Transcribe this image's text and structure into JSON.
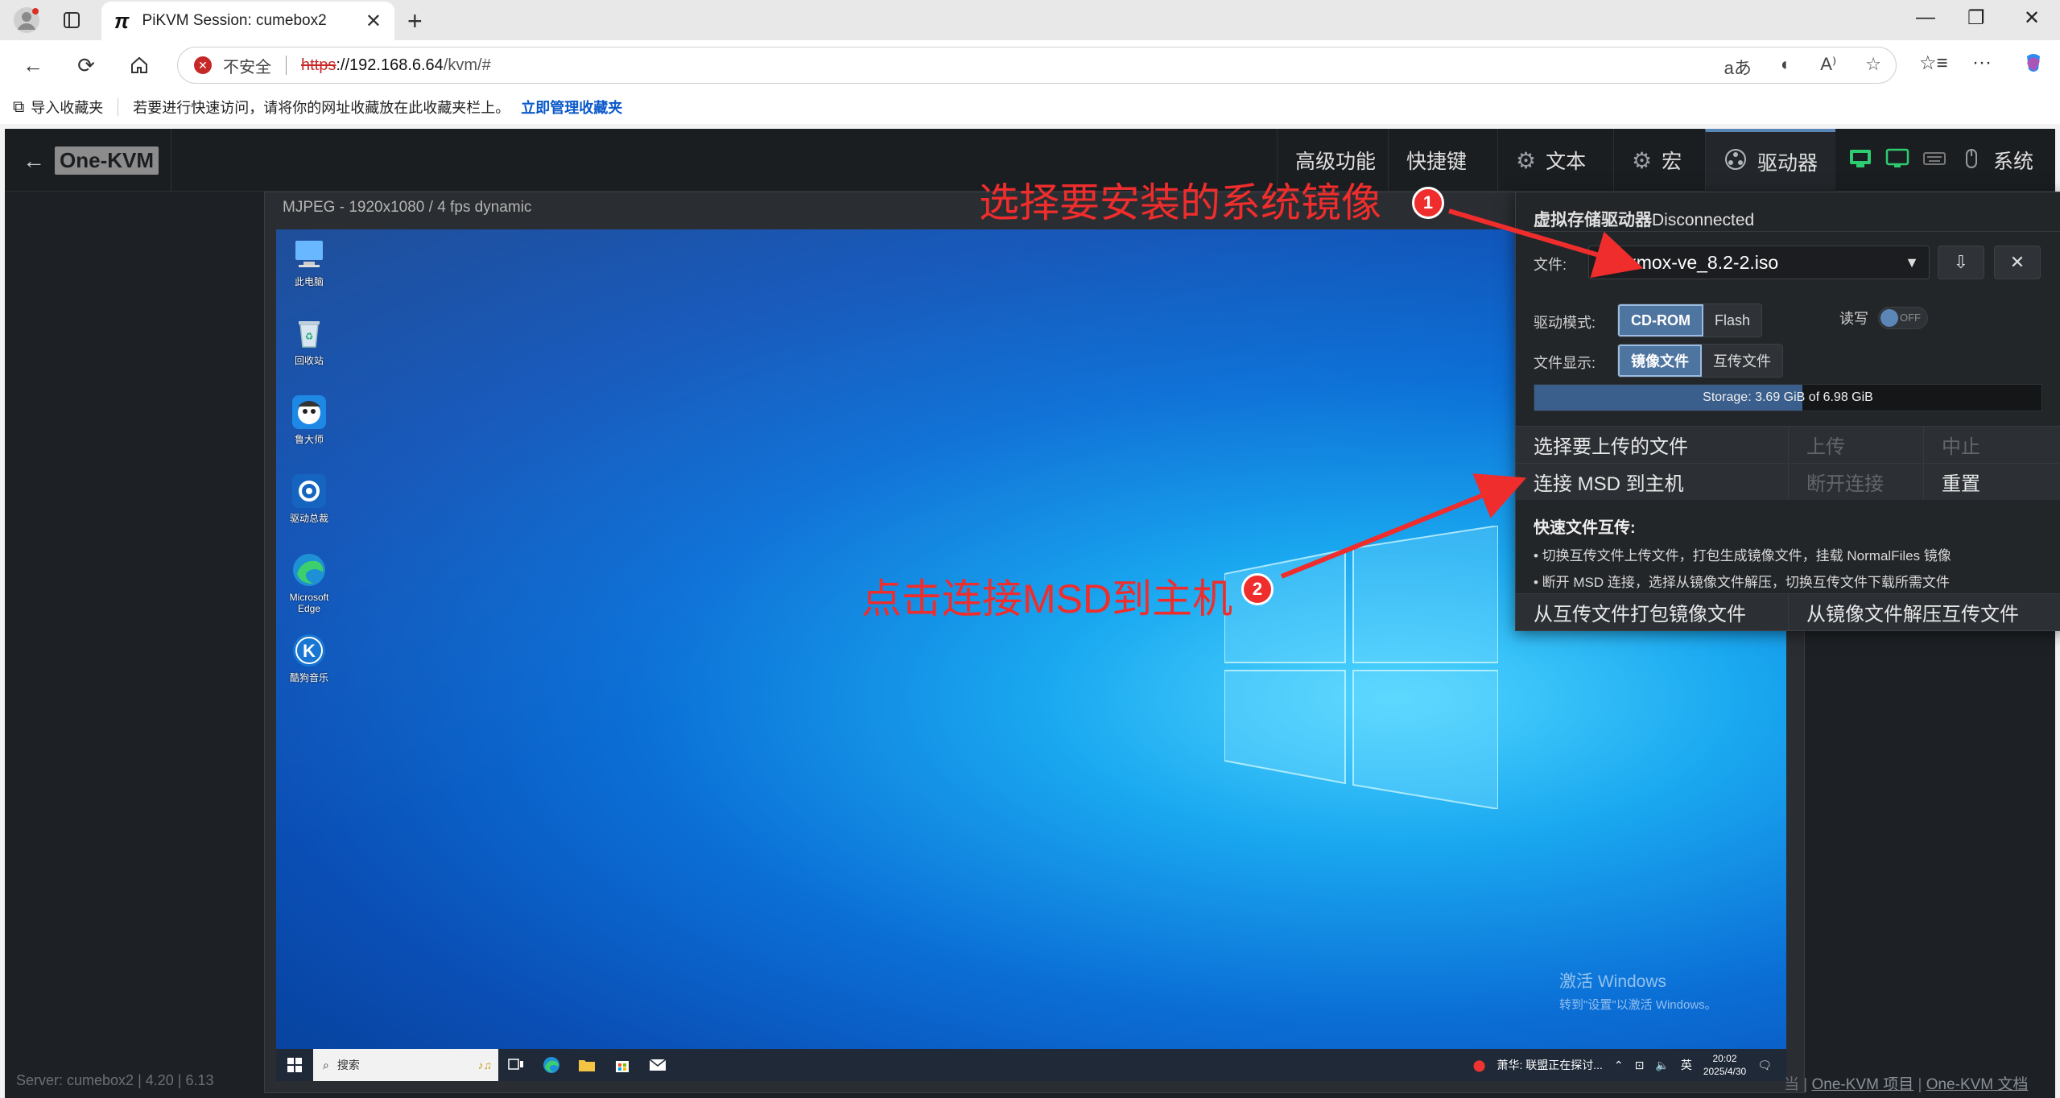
{
  "browser": {
    "tab_title": "PiKVM Session: cumebox2",
    "insecure_label": "不安全",
    "url_scheme": "https",
    "url_host": "://192.168.6.64",
    "url_path": "/kvm/#",
    "import_favorites": "导入收藏夹",
    "fav_hint": "若要进行快速访问，请将你的网址收藏放在此收藏夹栏上。",
    "fav_manage": "立即管理收藏夹"
  },
  "kvm": {
    "brand": "One-KVM",
    "menu": {
      "advanced": "高级功能",
      "shortcuts": "快捷键",
      "text": "文本",
      "macro": "宏",
      "drive": "驱动器",
      "system": "系统"
    },
    "stream_title": "MJPEG - 1920x1080 / 4 fps dynamic",
    "footer_left": "Server: cumebox2  |  4.20  |  6.13",
    "footer_right": {
      "sep1": "当  |  ",
      "project": "One-KVM 项目",
      "sep2": "  |  ",
      "docs": "One-KVM 文档"
    }
  },
  "desktop": {
    "icons": [
      {
        "label": "此电脑"
      },
      {
        "label": "回收站"
      },
      {
        "label": "鲁大师"
      },
      {
        "label": "驱动总裁"
      },
      {
        "label": "Microsoft Edge"
      },
      {
        "label": "酷狗音乐"
      }
    ],
    "activate_line1": "激活 Windows",
    "activate_line2": "转到\"设置\"以激活 Windows。",
    "taskbar": {
      "search_placeholder": "搜索",
      "news": "萧华: 联盟正在探讨...",
      "ime": "英",
      "time": "20:02",
      "date": "2025/4/30"
    }
  },
  "msd": {
    "title_bold": "虚拟存储驱动器",
    "title_status": "Disconnected",
    "file_label": "文件:",
    "file_value": "proxmox-ve_8.2-2.iso",
    "drive_mode_label": "驱动模式:",
    "mode_cdrom": "CD-ROM",
    "mode_flash": "Flash",
    "rw_label": "读写",
    "rw_state": "OFF",
    "file_display_label": "文件显示:",
    "disp_images": "镜像文件",
    "disp_transfer": "互传文件",
    "storage_text": "Storage: 3.69 GiB of 6.98 GiB",
    "storage_used_fraction": 0.529,
    "choose_upload": "选择要上传的文件",
    "upload": "上传",
    "abort": "中止",
    "connect": "连接 MSD 到主机",
    "disconnect": "断开连接",
    "reset": "重置",
    "tip_title": "快速文件互传:",
    "tip_line1": "• 切换互传文件上传文件，打包生成镜像文件，挂载 NormalFiles 镜像",
    "tip_line2": "• 断开 MSD 连接，选择从镜像文件解压，切换互传文件下载所需文件",
    "pack_button": "从互传文件打包镜像文件",
    "unpack_button": "从镜像文件解压互传文件"
  },
  "annotations": {
    "step1_text": "选择要安装的系统镜像",
    "step1_num": "1",
    "step2_text": "点击连接MSD到主机",
    "step2_num": "2",
    "color": "#ef2d2d"
  }
}
